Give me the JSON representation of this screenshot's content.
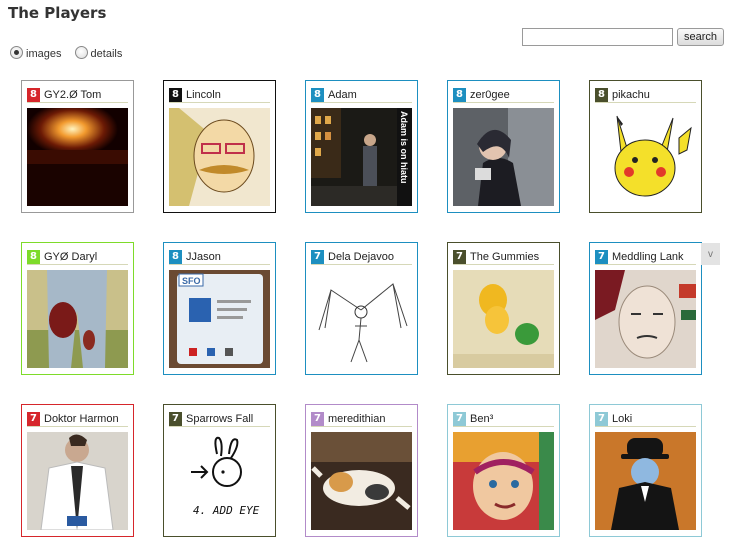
{
  "header": {
    "title": "The Players"
  },
  "view": {
    "options": [
      {
        "label": "images",
        "checked": true
      },
      {
        "label": "details",
        "checked": false
      }
    ]
  },
  "search": {
    "value": "",
    "placeholder": "",
    "button_label": "search"
  },
  "more_toggle": {
    "label": "v"
  },
  "colors": {
    "red": "#d6262b",
    "black": "#111111",
    "blue": "#1d8fc0",
    "olive": "#4a4f2c",
    "green": "#7edb2a",
    "lavender": "#b28bc9",
    "teal": "#8ec9d6"
  },
  "players": [
    {
      "name": "GY2.Ø Tom",
      "level": "8",
      "color": "#d6262b",
      "photo": "fire-at-night"
    },
    {
      "name": "Lincoln",
      "level": "8",
      "color": "#111111",
      "photo": "mustache-drawing"
    },
    {
      "name": "Adam",
      "level": "8",
      "color": "#1d8fc0",
      "photo": "night-street",
      "photo_text": "Adam is on hiatu"
    },
    {
      "name": "zer0gee",
      "level": "8",
      "color": "#1d8fc0",
      "photo": "girl-with-camera"
    },
    {
      "name": "pikachu",
      "level": "8",
      "color": "#4a4f2c",
      "photo": "pikachu"
    },
    {
      "name": "GYØ Daryl",
      "level": "8",
      "color": "#7edb2a",
      "photo": "stained-jeans"
    },
    {
      "name": "JJason",
      "level": "8",
      "color": "#1d8fc0",
      "photo": "screen-display",
      "photo_text": "SFO"
    },
    {
      "name": "Dela Dejavoo",
      "level": "7",
      "color": "#1d8fc0",
      "photo": "skeleton-sketch"
    },
    {
      "name": "The Gummies",
      "level": "7",
      "color": "#4a4f2c",
      "photo": "gummy-bears"
    },
    {
      "name": "Meddling Lank",
      "level": "7",
      "color": "#1d8fc0",
      "photo": "face-painting"
    },
    {
      "name": "Doktor Harmon",
      "level": "7",
      "color": "#d6262b",
      "photo": "man-in-coat"
    },
    {
      "name": "Sparrows Fall",
      "level": "7",
      "color": "#4a4f2c",
      "photo": "bunny-doodle",
      "photo_text": "4. ADD EYE"
    },
    {
      "name": "meredithian",
      "level": "7",
      "color": "#b28bc9",
      "photo": "sleeping-cat"
    },
    {
      "name": "Ben³",
      "level": "7",
      "color": "#8ec9d6",
      "photo": "colorful-face"
    },
    {
      "name": "Loki",
      "level": "7",
      "color": "#8ec9d6",
      "photo": "bowler-hat-man"
    }
  ]
}
